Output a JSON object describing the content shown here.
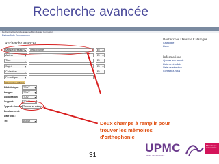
{
  "slide": {
    "title": "Recherche avancée",
    "page_number": "31",
    "annotation": "Deux champs à remplir pour trouver les mémoires d'orthophonie"
  },
  "app": {
    "menu_text": "Recherche   Recherche avancée   Mon dossier   Connexion",
    "breadcrumb": "Retour   Aide   Déconnexion",
    "search_title": "Recherche avancée",
    "criteria": [
      {
        "field": "Mots/expression",
        "value": "orthophonie",
        "op": "Et"
      },
      {
        "field": "Auteur",
        "value": "",
        "op": "Et"
      },
      {
        "field": "Titre",
        "value": "",
        "op": "Et"
      },
      {
        "field": "Sujet",
        "value": "",
        "op": "Et"
      },
      {
        "field": "Collection",
        "value": "",
        "op": "Et"
      },
      {
        "field": "Périodique",
        "value": "",
        "op": ""
      }
    ],
    "buttons": {
      "search": "Rechercher",
      "reset": "Effacer"
    },
    "limits": [
      {
        "label": "Bibliothèque:",
        "value": "TOUT"
      },
      {
        "label": "Langue:",
        "value": "TOUT"
      },
      {
        "label": "Localisation:",
        "value": "TOUT"
      },
      {
        "label": "Support:",
        "value": "TOUT"
      },
      {
        "label": "Type de document:",
        "value": "Thèses et mémoires"
      },
      {
        "label": "Emplacement:",
        "value": ""
      },
      {
        "label": "Date pub.:",
        "value": ""
      },
      {
        "label": "Tri:",
        "value": "Aucun"
      }
    ],
    "sidebar": {
      "heading1": "Recherches Dans Le Catalogue",
      "links1": [
        "Catalogue",
        "Liens"
      ],
      "heading2": "Informations",
      "links2": [
        "Ajoutez aux favoris",
        "Liste de résultats",
        "Liste de sélection",
        "Contactez-nous"
      ]
    }
  },
  "logo": {
    "text": "UPMC",
    "subtext": "PARIS UNIVERSITAS",
    "tag": "Bibliothèque Universitaire"
  },
  "colors": {
    "annotation": "#e04f10",
    "ring": "#d81e1e",
    "title": "#4a4a9a",
    "logo": "#6b3a8c"
  }
}
